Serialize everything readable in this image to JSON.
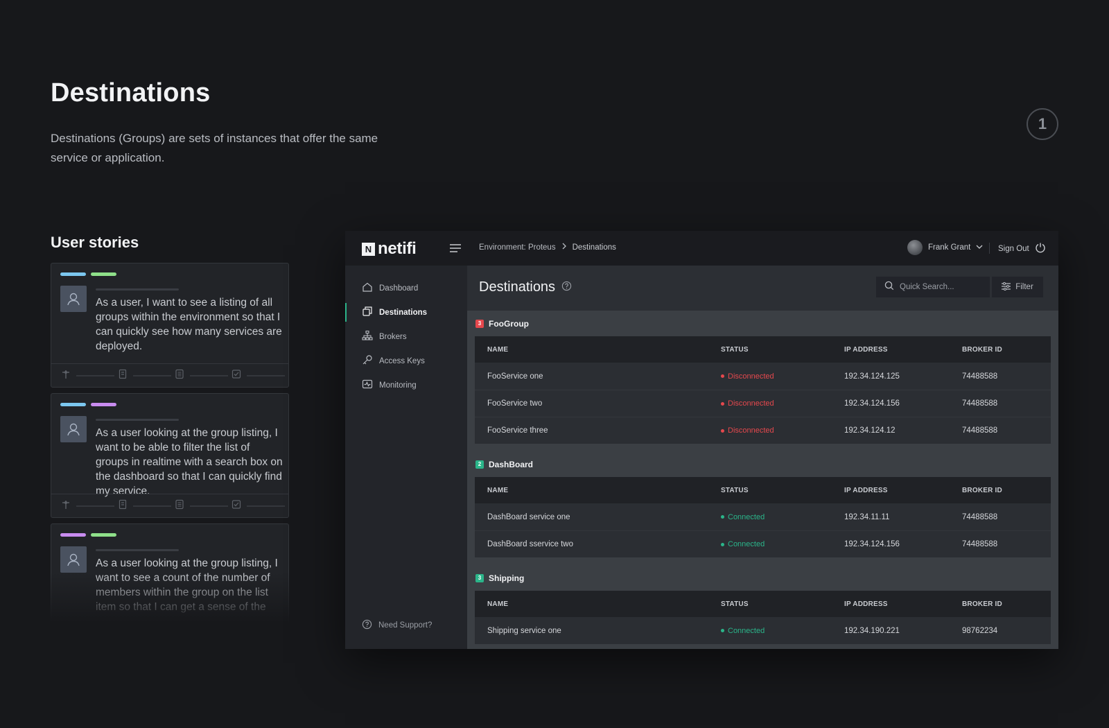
{
  "presentation": {
    "title": "Destinations",
    "description": "Destinations (Groups) are sets of instances that offer the same service or application.",
    "step": "1",
    "stories_title": "User stories"
  },
  "stories": [
    {
      "tags": [
        "#7cc7ef",
        "#8fe08a"
      ],
      "text": "As a user, I want to see a listing of all groups within the environment so that I can quickly see how many services are deployed."
    },
    {
      "tags": [
        "#7cc7ef",
        "#c98cf0"
      ],
      "text": "As a user looking at the group listing, I want to be able to filter the list of groups in realtime with a search box on the dashboard so that I can quickly find my service."
    },
    {
      "tags": [
        "#c98cf0",
        "#8fe08a"
      ],
      "text": "As a user looking at the group listing, I want to see a count of the number of members within the group on the list item so that I can get a sense of the"
    }
  ],
  "app": {
    "logo_mark": "N",
    "logo_text": "netifi",
    "breadcrumb": {
      "env": "Environment: Proteus",
      "current": "Destinations"
    },
    "user_name": "Frank Grant",
    "signout": "Sign Out",
    "nav": [
      {
        "label": "Dashboard",
        "icon": "home-icon"
      },
      {
        "label": "Destinations",
        "icon": "destinations-icon"
      },
      {
        "label": "Brokers",
        "icon": "brokers-icon"
      },
      {
        "label": "Access Keys",
        "icon": "key-icon"
      },
      {
        "label": "Monitoring",
        "icon": "monitoring-icon"
      }
    ],
    "support": "Need Support?",
    "main_title": "Destinations",
    "search_placeholder": "Quick Search...",
    "filter_label": "Filter",
    "columns": [
      "NAME",
      "STATUS",
      "IP ADDRESS",
      "BROKER ID"
    ],
    "colors": {
      "disconnected": "#e5484d",
      "connected": "#2bb58a",
      "accent": "#2bb58a"
    },
    "groups": [
      {
        "name": "FooGroup",
        "count": "3",
        "badge_color": "#e5484d",
        "rows": [
          {
            "name": "FooService one",
            "status": "Disconnected",
            "state": "disconnected",
            "ip": "192.34.124.125",
            "broker": "74488588"
          },
          {
            "name": "FooService two",
            "status": "Disconnected",
            "state": "disconnected",
            "ip": "192.34.124.156",
            "broker": "74488588"
          },
          {
            "name": "FooService three",
            "status": "Disconnected",
            "state": "disconnected",
            "ip": "192.34.124.12",
            "broker": "74488588"
          }
        ]
      },
      {
        "name": "DashBoard",
        "count": "2",
        "badge_color": "#2bb58a",
        "rows": [
          {
            "name": "DashBoard service one",
            "status": "Connected",
            "state": "connected",
            "ip": "192.34.11.11",
            "broker": "74488588"
          },
          {
            "name": "DashBoard sservice two",
            "status": "Connected",
            "state": "connected",
            "ip": "192.34.124.156",
            "broker": "74488588"
          }
        ]
      },
      {
        "name": "Shipping",
        "count": "3",
        "badge_color": "#2bb58a",
        "rows": [
          {
            "name": "Shipping service one",
            "status": "Connected",
            "state": "connected",
            "ip": "192.34.190.221",
            "broker": "98762234"
          }
        ]
      }
    ]
  }
}
